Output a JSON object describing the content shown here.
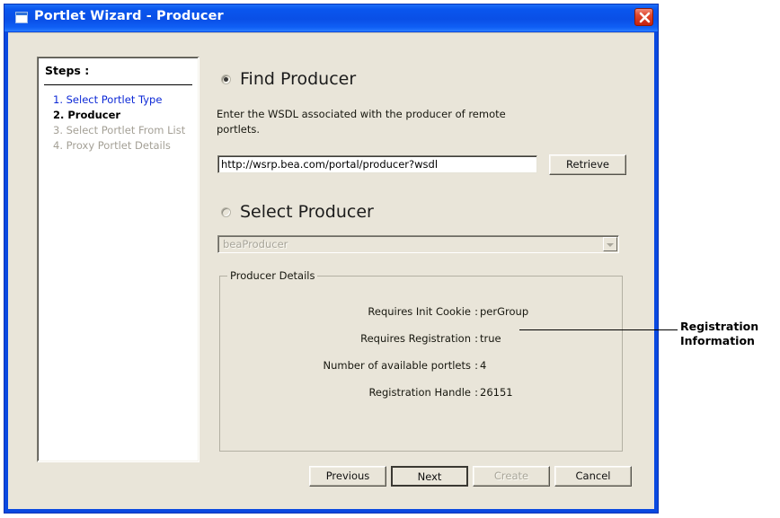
{
  "window": {
    "title": "Portlet Wizard - Producer",
    "icon": "window-icon",
    "close_icon": "close-icon"
  },
  "steps_panel": {
    "heading": "Steps :",
    "items": [
      {
        "label": "1. Select Portlet Type",
        "state": "done"
      },
      {
        "label": "2. Producer",
        "state": "current"
      },
      {
        "label": "3. Select Portlet From List",
        "state": "disabled"
      },
      {
        "label": "4. Proxy Portlet Details",
        "state": "disabled"
      }
    ]
  },
  "find_producer": {
    "radio_label": "Find Producer",
    "selected": true,
    "description": "Enter the WSDL associated with the producer of remote portlets.",
    "wsdl_value": "http://wsrp.bea.com/portal/producer?wsdl",
    "wsdl_placeholder": "",
    "retrieve_label": "Retrieve"
  },
  "select_producer": {
    "radio_label": "Select Producer",
    "selected": false,
    "dropdown_value": "beaProducer",
    "dropdown_enabled": false
  },
  "producer_details": {
    "legend": "Producer Details",
    "rows": [
      {
        "label": "Requires Init Cookie",
        "separator": ":",
        "value": "perGroup"
      },
      {
        "label": "Requires Registration",
        "separator": ":",
        "value": "true"
      },
      {
        "label": "Number of available portlets",
        "separator": ":",
        "value": "4"
      },
      {
        "label": "Registration Handle",
        "separator": ":",
        "value": "26151"
      }
    ]
  },
  "buttons": {
    "previous": "Previous",
    "next": "Next",
    "create": "Create",
    "cancel": "Cancel",
    "create_enabled": false,
    "next_focused": true
  },
  "annotation": {
    "line1": "Registration",
    "line2": "Information"
  },
  "colors": {
    "titlebar_blue": "#0a4fe6",
    "window_border_blue": "#0a49e0",
    "dialog_beige": "#e9e5d9",
    "step_done_blue": "#0d29d6",
    "step_disabled_gray": "#a4a096",
    "close_red": "#c8210c"
  }
}
